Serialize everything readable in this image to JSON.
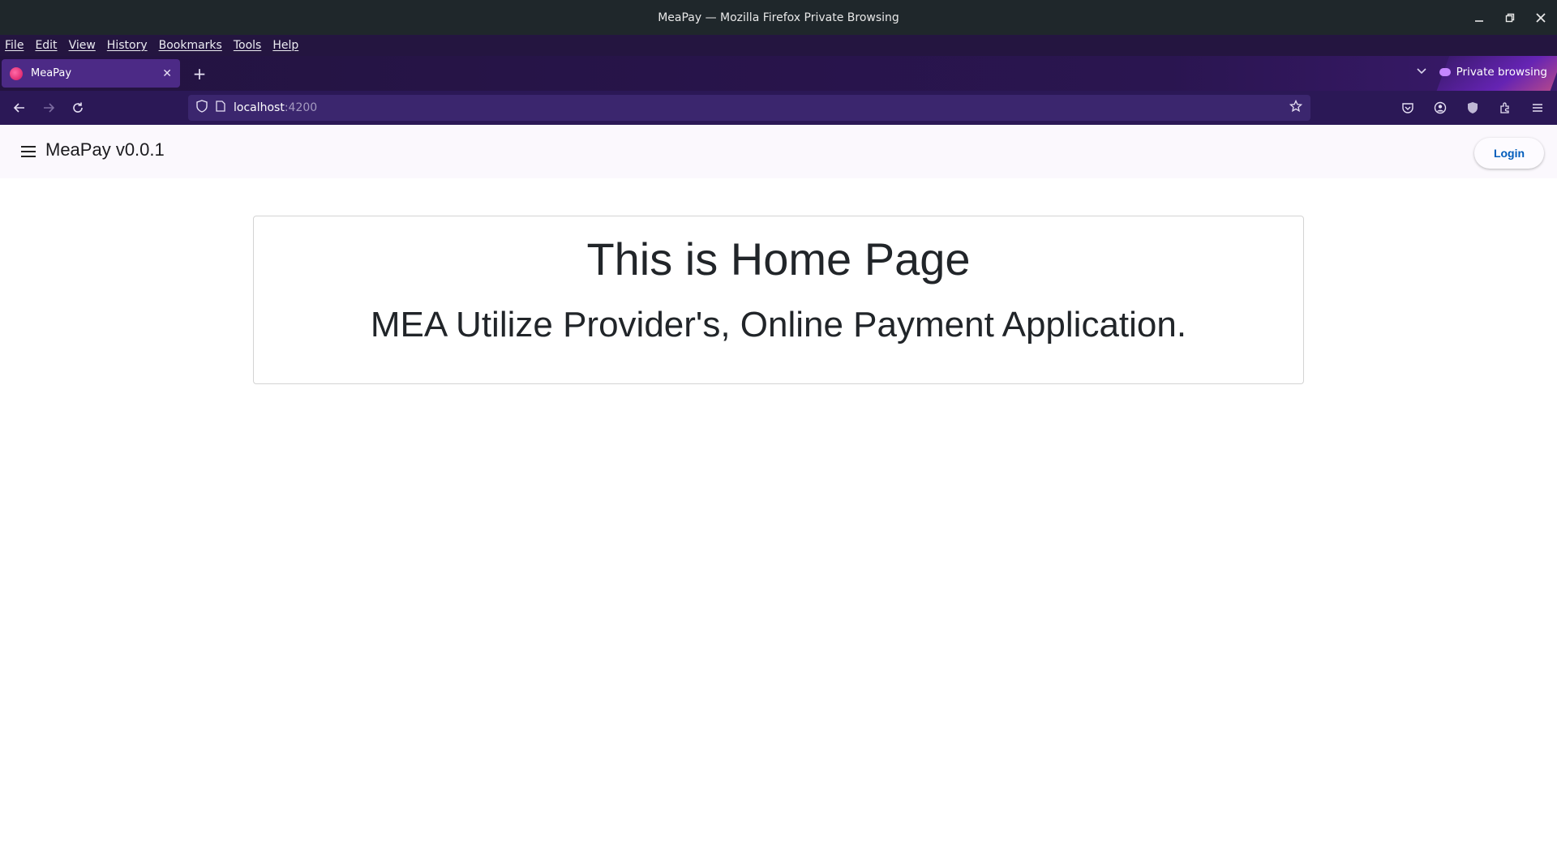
{
  "window": {
    "title": "MeaPay — Mozilla Firefox Private Browsing",
    "controls": {
      "minimize_icon": "minimize-icon",
      "restore_icon": "restore-icon",
      "close_icon": "close-icon"
    }
  },
  "menubar": {
    "items": [
      "File",
      "Edit",
      "View",
      "History",
      "Bookmarks",
      "Tools",
      "Help"
    ]
  },
  "tabs": [
    {
      "title": "MeaPay",
      "active": true
    }
  ],
  "private_badge": "Private browsing",
  "urlbar": {
    "host": "localhost",
    "port": ":4200"
  },
  "app": {
    "title": "MeaPay v0.0.1",
    "login_label": "Login",
    "brand_color": "#005cbb"
  },
  "home": {
    "heading": "This is Home Page",
    "subheading": "MEA Utilize Provider's, Online Payment Application."
  }
}
